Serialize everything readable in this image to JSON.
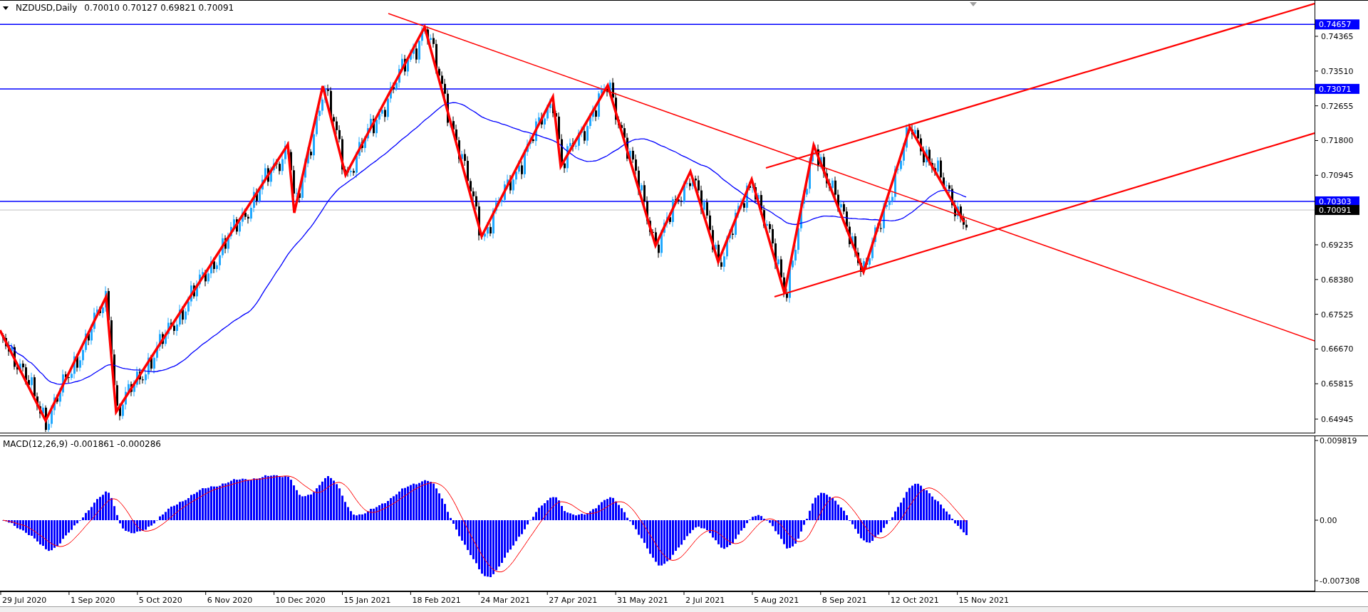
{
  "chart_header": {
    "symbol": "NZDUSD,Daily",
    "ohlc": "0.70010 0.70127 0.69821 0.70091"
  },
  "price_axis": {
    "ticks": [
      "0.74365",
      "0.73510",
      "0.72655",
      "0.71800",
      "0.70945",
      "0.69235",
      "0.68380",
      "0.67525",
      "0.66670",
      "0.65815",
      "0.64945"
    ]
  },
  "price_labels": [
    {
      "text": "0.74657",
      "kind": "level"
    },
    {
      "text": "0.73071",
      "kind": "level"
    },
    {
      "text": "0.70303",
      "kind": "level"
    },
    {
      "text": "0.70091",
      "kind": "bid"
    }
  ],
  "indicator": {
    "title": "MACD(12,26,9) -0.001861 -0.000286",
    "ticks": [
      "0.009819",
      "0.00",
      "-0.007308"
    ]
  },
  "time_axis": [
    "29 Jul 2020",
    "1 Sep 2020",
    "5 Oct 2020",
    "6 Nov 2020",
    "10 Dec 2020",
    "15 Jan 2021",
    "18 Feb 2021",
    "24 Mar 2021",
    "27 Apr 2021",
    "31 May 2021",
    "2 Jul 2021",
    "5 Aug 2021",
    "8 Sep 2021",
    "12 Oct 2021",
    "15 Nov 2021"
  ]
}
